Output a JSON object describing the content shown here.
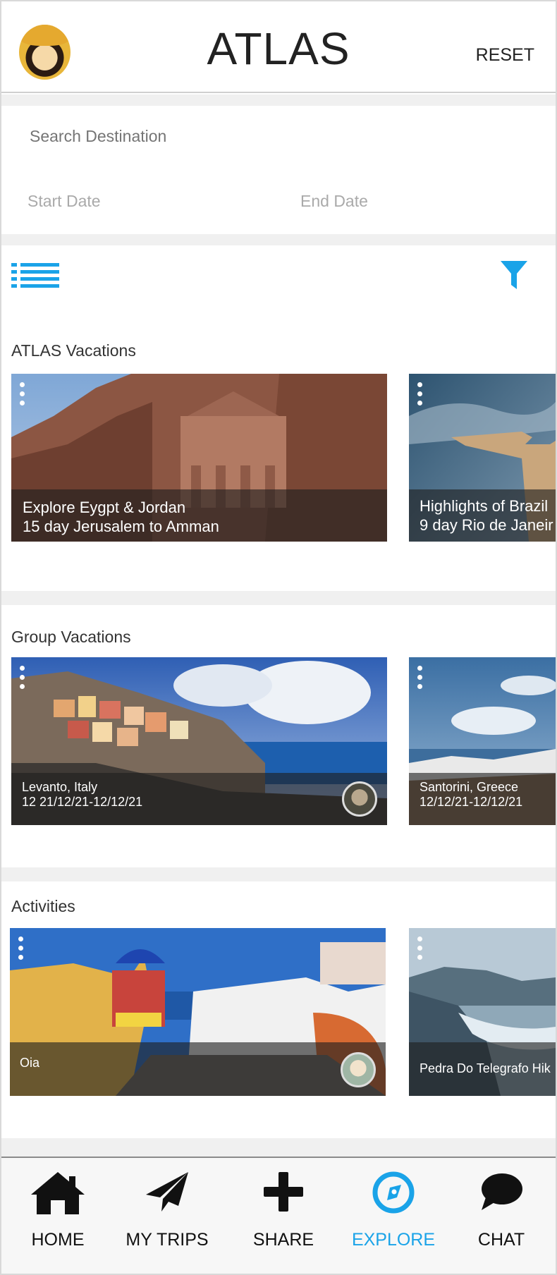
{
  "header": {
    "title": "ATLAS",
    "reset_label": "RESET",
    "avatar_icon": "user-avatar"
  },
  "search": {
    "destination_placeholder": "Search Destination",
    "start_date_placeholder": "Start Date",
    "end_date_placeholder": "End Date"
  },
  "toolbar": {
    "list_icon": "list-view-icon",
    "filter_icon": "filter-icon"
  },
  "colors": {
    "accent": "#1aa3e8",
    "text": "#333333",
    "placeholder": "#aaaaaa",
    "separator": "#f0f0f0"
  },
  "sections": [
    {
      "title": "ATLAS  Vacations",
      "cards": [
        {
          "line1": "Explore  Eygpt & Jordan",
          "line2": "15 day Jerusalem to Amman"
        },
        {
          "line1": "Highlights of Brazil",
          "line2": "9 day Rio de Janeir"
        }
      ]
    },
    {
      "title": "Group Vacations",
      "cards": [
        {
          "line1": "Levanto, Italy",
          "line2": "12 21/12/21-12/12/21"
        },
        {
          "line1": "Santorini, Greece",
          "line2": "12/12/21-12/12/21"
        }
      ]
    },
    {
      "title": "Activities",
      "cards": [
        {
          "line1": "Oia"
        },
        {
          "line1": "Pedra Do Telegrafo Hik"
        }
      ]
    }
  ],
  "bottom_nav": [
    {
      "label": "HOME",
      "icon": "home-icon"
    },
    {
      "label": "MY TRIPS",
      "icon": "paper-plane-icon"
    },
    {
      "label": "SHARE",
      "icon": "plus-icon"
    },
    {
      "label": "EXPLORE",
      "icon": "compass-icon",
      "active": true
    },
    {
      "label": "CHAT",
      "icon": "chat-bubble-icon"
    }
  ]
}
